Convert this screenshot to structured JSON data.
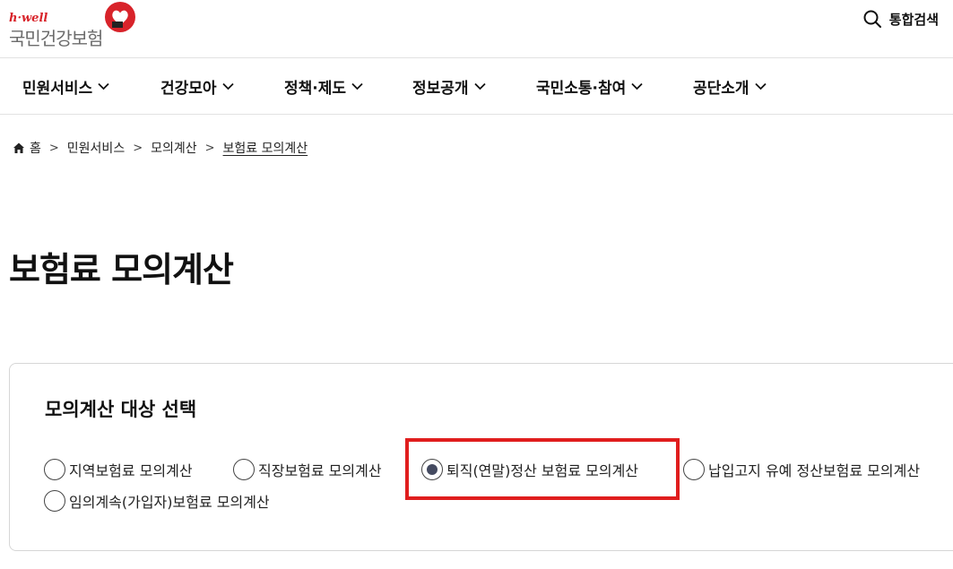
{
  "header": {
    "logo_sub": "h·well",
    "logo_main": "국민건강보험",
    "search_label": "통합검색",
    "brand_color": "#d8232a"
  },
  "nav": {
    "items": [
      {
        "label": "민원서비스"
      },
      {
        "label": "건강모아"
      },
      {
        "label": "정책·제도"
      },
      {
        "label": "정보공개"
      },
      {
        "label": "국민소통·참여"
      },
      {
        "label": "공단소개"
      }
    ]
  },
  "breadcrumb": {
    "home": "홈",
    "items": [
      "민원서비스",
      "모의계산",
      "보험료 모의계산"
    ]
  },
  "page": {
    "title": "보험료 모의계산"
  },
  "panel": {
    "title": "모의계산 대상 선택",
    "options": [
      {
        "label": "지역보험료 모의계산",
        "selected": false
      },
      {
        "label": "직장보험료 모의계산",
        "selected": false
      },
      {
        "label": "퇴직(연말)정산 보험료 모의계산",
        "selected": true
      },
      {
        "label": "납입고지 유예 정산보험료 모의계산",
        "selected": false
      },
      {
        "label": "임의계속(가입자)보험료 모의계산",
        "selected": false
      }
    ]
  },
  "highlight_color": "#e01e1e"
}
